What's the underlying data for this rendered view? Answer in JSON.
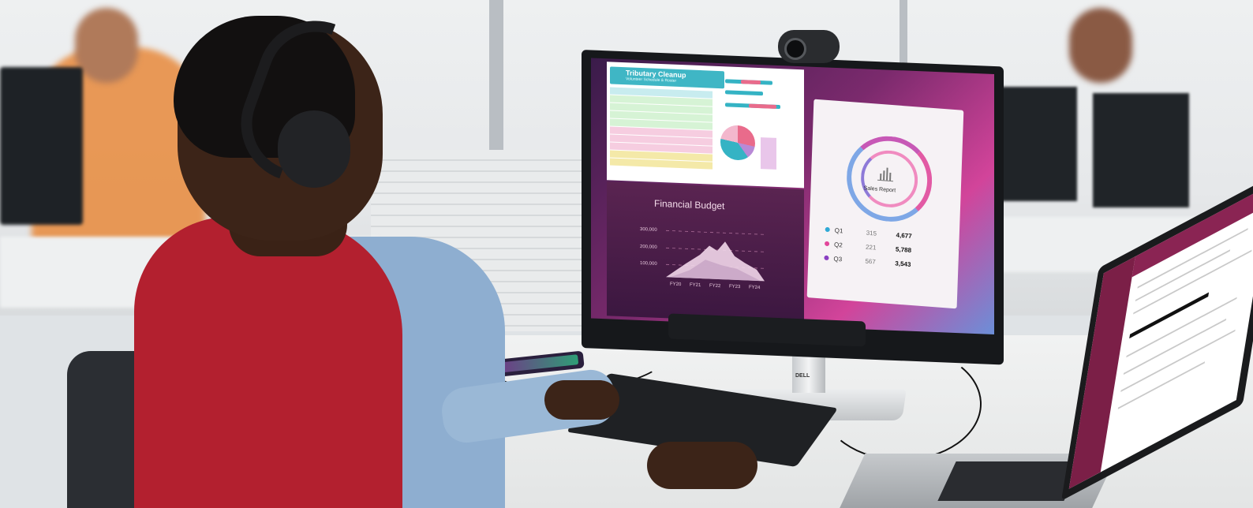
{
  "scene": {
    "description_label": "Office workspace photo",
    "brand": "DELL"
  },
  "spreadsheet": {
    "title": "Tributary Cleanup",
    "subtitle": "Volunteer Schedule & Roster"
  },
  "budget_chart": {
    "title": "Financial Budget",
    "y_ticks": [
      "300,000",
      "200,000",
      "100,000"
    ],
    "x_ticks": [
      "FY20",
      "FY21",
      "FY22",
      "FY23",
      "FY24"
    ]
  },
  "sales_report": {
    "title": "Sales Report",
    "rows": [
      {
        "label": "Q1",
        "a": "315",
        "b": "4,677",
        "color": "#2fa9d6"
      },
      {
        "label": "Q2",
        "a": "221",
        "b": "5,788",
        "color": "#e2459a"
      },
      {
        "label": "Q3",
        "a": "567",
        "b": "3,543",
        "color": "#8a3fc2"
      }
    ]
  },
  "colors": {
    "hoodie": "#b3202f",
    "shirt": "#8eaed0",
    "monitor_bezel": "#16181b",
    "accent_teal": "#3fb6c5",
    "accent_pink": "#e2459a"
  }
}
